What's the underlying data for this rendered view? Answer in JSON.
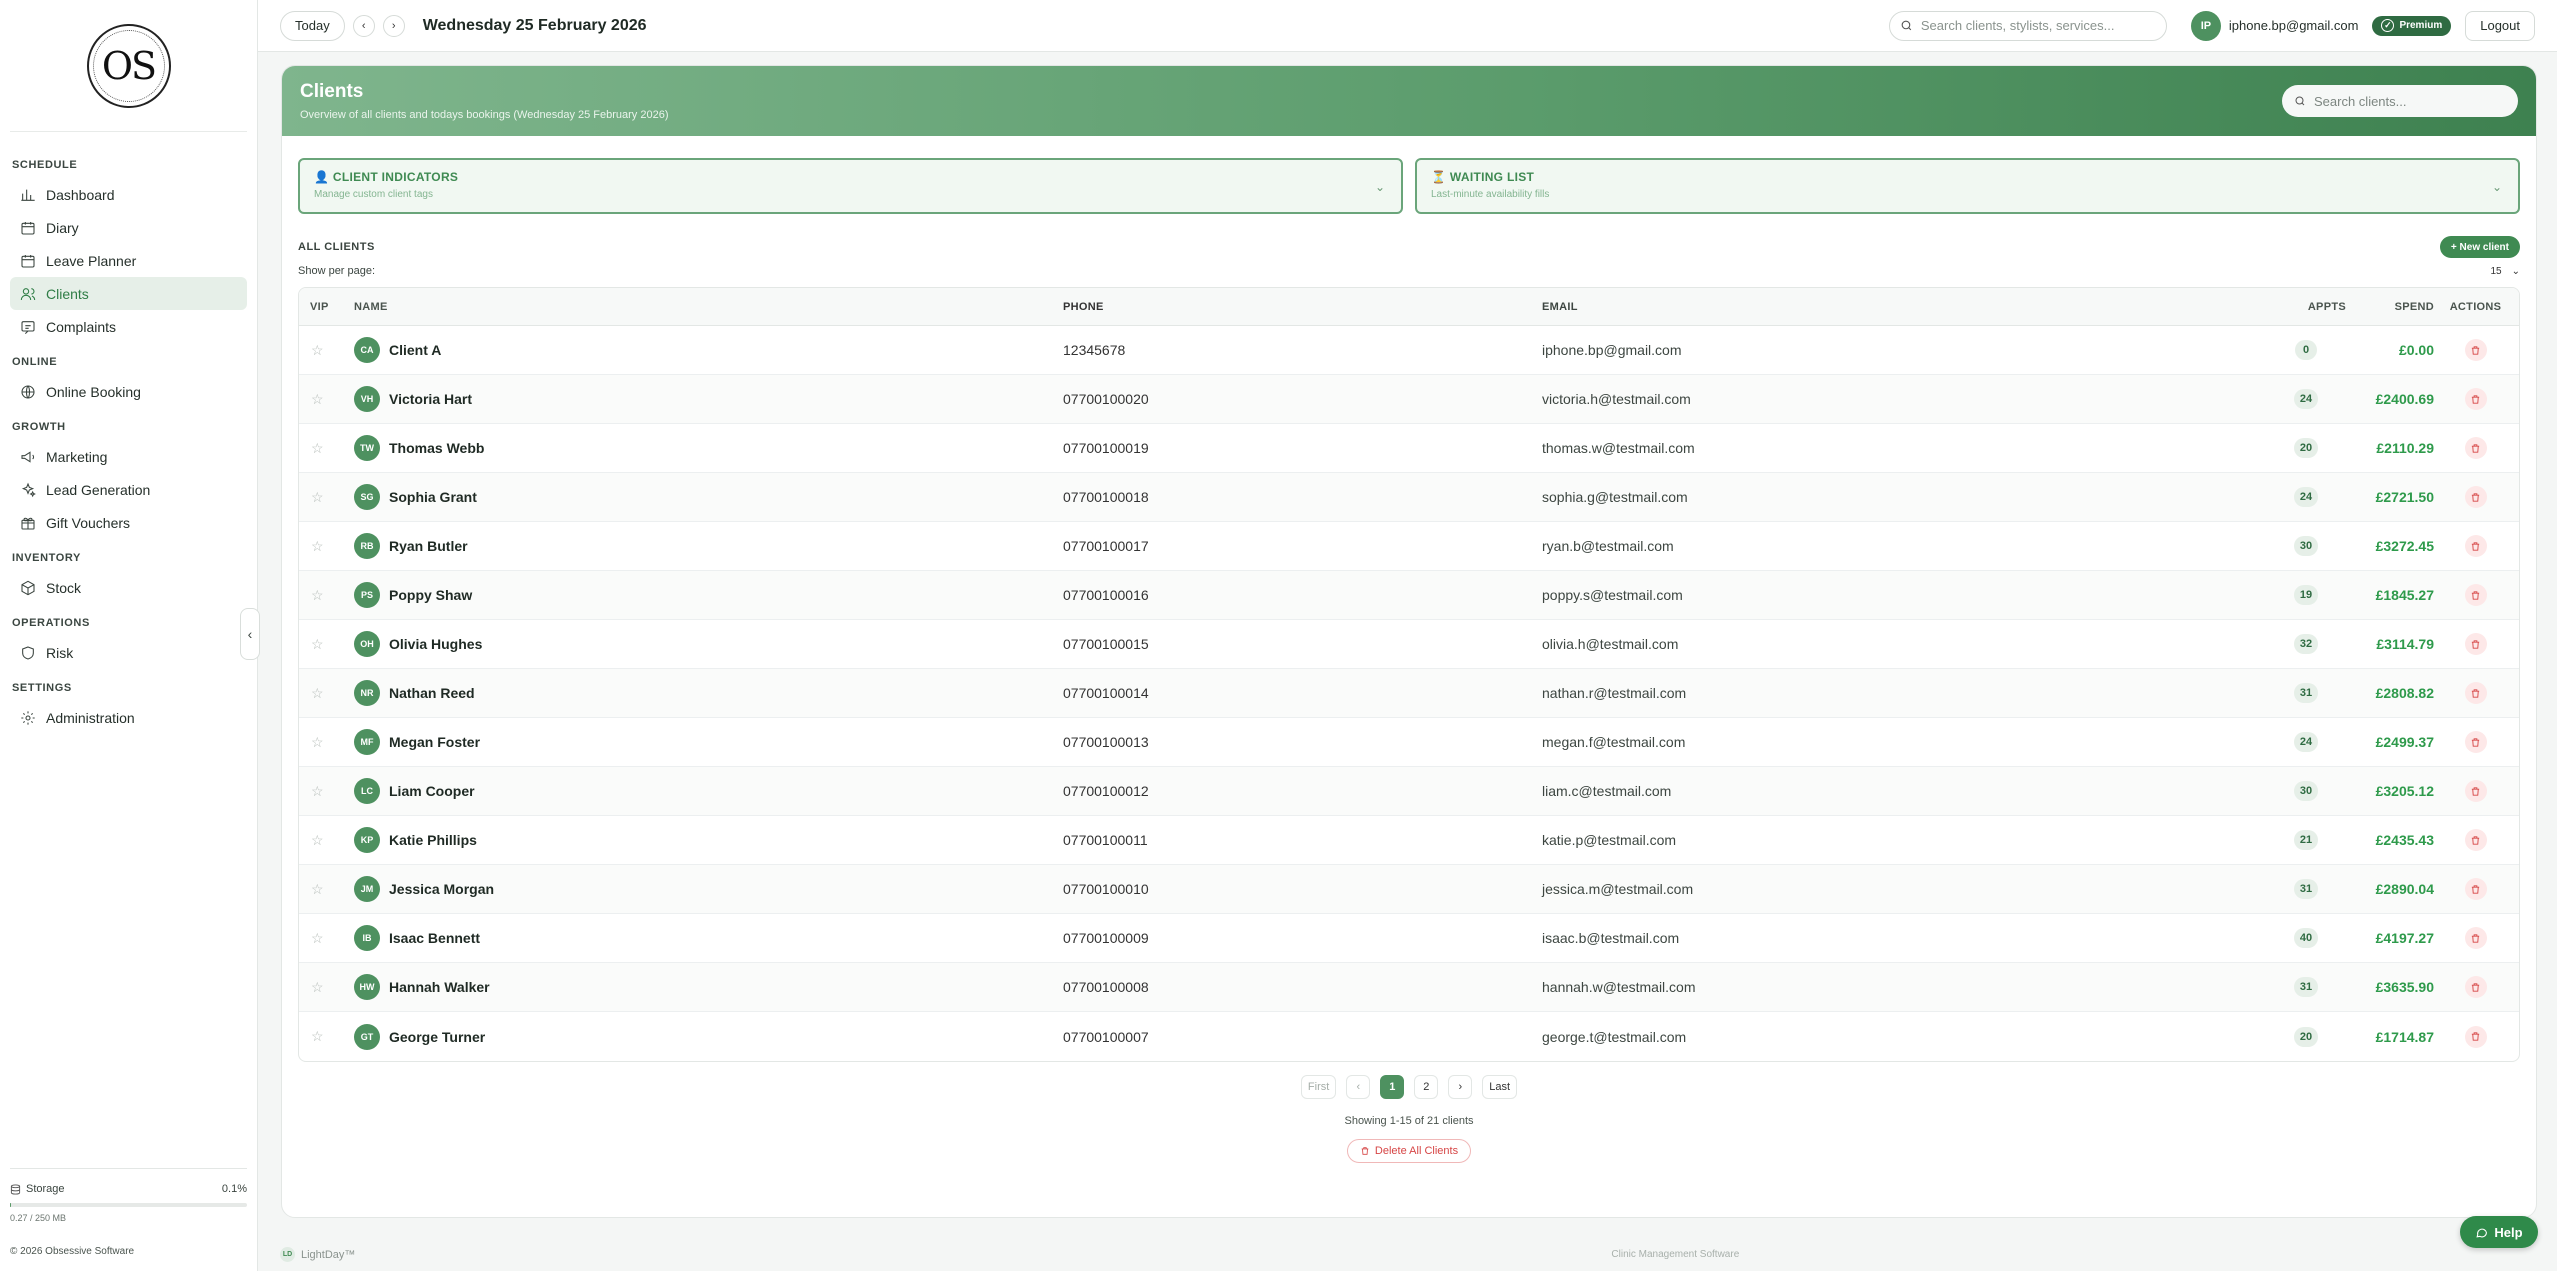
{
  "brand": {
    "logo_text": "OS"
  },
  "sidebar": {
    "sections": [
      {
        "title": "SCHEDULE",
        "items": [
          {
            "label": "Dashboard",
            "icon": "chart-icon",
            "active": false
          },
          {
            "label": "Diary",
            "icon": "calendar-icon",
            "active": false
          },
          {
            "label": "Leave Planner",
            "icon": "calendar-icon",
            "active": false
          },
          {
            "label": "Clients",
            "icon": "users-icon",
            "active": true
          },
          {
            "label": "Complaints",
            "icon": "message-icon",
            "active": false
          }
        ]
      },
      {
        "title": "ONLINE",
        "items": [
          {
            "label": "Online Booking",
            "icon": "globe-icon",
            "active": false
          }
        ]
      },
      {
        "title": "GROWTH",
        "items": [
          {
            "label": "Marketing",
            "icon": "megaphone-icon",
            "active": false
          },
          {
            "label": "Lead Generation",
            "icon": "sparkle-icon",
            "active": false
          },
          {
            "label": "Gift Vouchers",
            "icon": "gift-icon",
            "active": false
          }
        ]
      },
      {
        "title": "INVENTORY",
        "items": [
          {
            "label": "Stock",
            "icon": "box-icon",
            "active": false
          }
        ]
      },
      {
        "title": "OPERATIONS",
        "items": [
          {
            "label": "Risk",
            "icon": "shield-icon",
            "active": false
          }
        ]
      },
      {
        "title": "SETTINGS",
        "items": [
          {
            "label": "Administration",
            "icon": "gear-icon",
            "active": false
          }
        ]
      }
    ],
    "storage": {
      "label": "Storage",
      "percent": "0.1%",
      "fraction": 0.001,
      "detail": "0.27 / 250 MB"
    },
    "copyright": "© 2026 Obsessive Software"
  },
  "topbar": {
    "today_label": "Today",
    "date": "Wednesday 25 February 2026",
    "search_placeholder": "Search clients, stylists, services...",
    "user_initials": "IP",
    "user_email": "iphone.bp@gmail.com",
    "plan": "Premium",
    "logout_label": "Logout"
  },
  "page": {
    "title": "Clients",
    "subtitle": "Overview of all clients and todays bookings (Wednesday 25 February 2026)",
    "search_placeholder": "Search clients...",
    "panels": [
      {
        "title": "CLIENT INDICATORS",
        "sub": "Manage custom client tags",
        "emoji": "👤"
      },
      {
        "title": "WAITING LIST",
        "sub": "Last-minute availability fills",
        "emoji": "⏳"
      }
    ],
    "list_title": "ALL CLIENTS",
    "new_client_label": "+ New client",
    "per_page_label": "Show per page:",
    "per_page_value": "15"
  },
  "table": {
    "headers": {
      "vip": "VIP",
      "name": "NAME",
      "phone": "PHONE",
      "email": "EMAIL",
      "appts": "APPTS",
      "spend": "SPEND",
      "actions": "ACTIONS"
    },
    "rows": [
      {
        "initials": "CA",
        "name": "Client A",
        "phone": "12345678",
        "email": "iphone.bp@gmail.com",
        "appts": "0",
        "spend": "£0.00"
      },
      {
        "initials": "VH",
        "name": "Victoria Hart",
        "phone": "07700100020",
        "email": "victoria.h@testmail.com",
        "appts": "24",
        "spend": "£2400.69"
      },
      {
        "initials": "TW",
        "name": "Thomas Webb",
        "phone": "07700100019",
        "email": "thomas.w@testmail.com",
        "appts": "20",
        "spend": "£2110.29"
      },
      {
        "initials": "SG",
        "name": "Sophia Grant",
        "phone": "07700100018",
        "email": "sophia.g@testmail.com",
        "appts": "24",
        "spend": "£2721.50"
      },
      {
        "initials": "RB",
        "name": "Ryan Butler",
        "phone": "07700100017",
        "email": "ryan.b@testmail.com",
        "appts": "30",
        "spend": "£3272.45"
      },
      {
        "initials": "PS",
        "name": "Poppy Shaw",
        "phone": "07700100016",
        "email": "poppy.s@testmail.com",
        "appts": "19",
        "spend": "£1845.27"
      },
      {
        "initials": "OH",
        "name": "Olivia Hughes",
        "phone": "07700100015",
        "email": "olivia.h@testmail.com",
        "appts": "32",
        "spend": "£3114.79"
      },
      {
        "initials": "NR",
        "name": "Nathan Reed",
        "phone": "07700100014",
        "email": "nathan.r@testmail.com",
        "appts": "31",
        "spend": "£2808.82"
      },
      {
        "initials": "MF",
        "name": "Megan Foster",
        "phone": "07700100013",
        "email": "megan.f@testmail.com",
        "appts": "24",
        "spend": "£2499.37"
      },
      {
        "initials": "LC",
        "name": "Liam Cooper",
        "phone": "07700100012",
        "email": "liam.c@testmail.com",
        "appts": "30",
        "spend": "£3205.12"
      },
      {
        "initials": "KP",
        "name": "Katie Phillips",
        "phone": "07700100011",
        "email": "katie.p@testmail.com",
        "appts": "21",
        "spend": "£2435.43"
      },
      {
        "initials": "JM",
        "name": "Jessica Morgan",
        "phone": "07700100010",
        "email": "jessica.m@testmail.com",
        "appts": "31",
        "spend": "£2890.04"
      },
      {
        "initials": "IB",
        "name": "Isaac Bennett",
        "phone": "07700100009",
        "email": "isaac.b@testmail.com",
        "appts": "40",
        "spend": "£4197.27"
      },
      {
        "initials": "HW",
        "name": "Hannah Walker",
        "phone": "07700100008",
        "email": "hannah.w@testmail.com",
        "appts": "31",
        "spend": "£3635.90"
      },
      {
        "initials": "GT",
        "name": "George Turner",
        "phone": "07700100007",
        "email": "george.t@testmail.com",
        "appts": "20",
        "spend": "£1714.87"
      }
    ]
  },
  "pagination": {
    "first": "First",
    "prev": "‹",
    "pages": [
      "1",
      "2"
    ],
    "current": "1",
    "next": "›",
    "last": "Last",
    "showing": "Showing 1-15 of 21 clients",
    "delete_all": "Delete All Clients"
  },
  "footer": {
    "app_initials": "LD",
    "app_name": "LightDay™",
    "tagline": "Clinic Management Software",
    "help_label": "Help"
  },
  "colors": {
    "accent": "#3f8a52",
    "spend": "#2e9a4b",
    "danger": "#d64545"
  }
}
